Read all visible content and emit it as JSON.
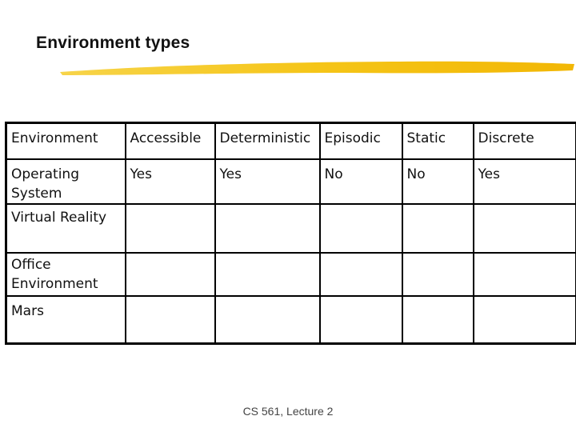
{
  "slide": {
    "title": "Environment types",
    "accent_color": "#f5c518",
    "footer": "CS 561,  Lecture 2"
  },
  "table": {
    "headers": [
      "Environment",
      "Accessible",
      "Deterministic",
      "Episodic",
      "Static",
      "Discrete"
    ],
    "rows": [
      [
        "Operating System",
        "Yes",
        "Yes",
        "No",
        "No",
        "Yes"
      ],
      [
        "Virtual Reality",
        "",
        "",
        "",
        "",
        ""
      ],
      [
        "Office Environment",
        "",
        "",
        "",
        "",
        ""
      ],
      [
        "Mars",
        "",
        "",
        "",
        "",
        ""
      ]
    ]
  }
}
